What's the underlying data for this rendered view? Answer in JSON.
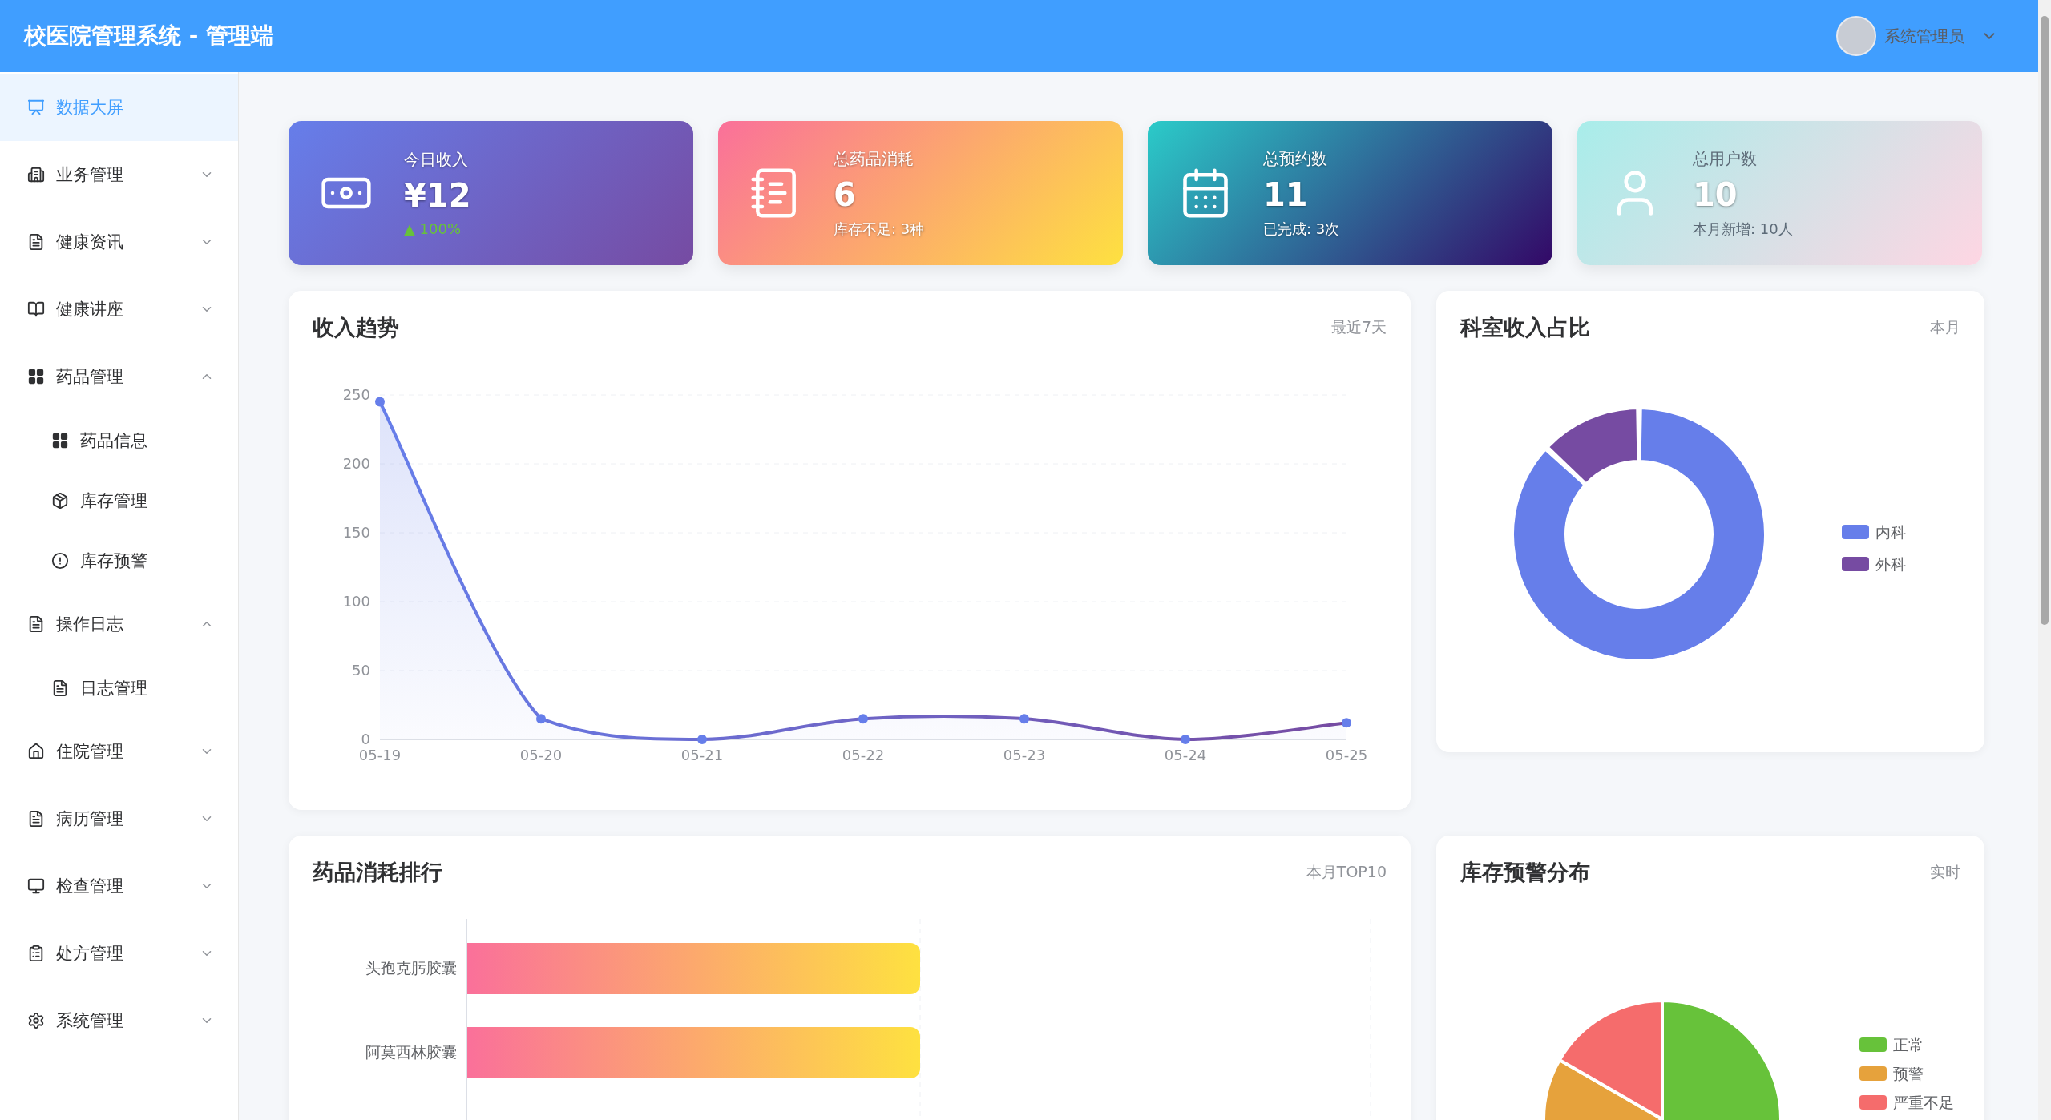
{
  "header": {
    "title": "校医院管理系统 - 管理端",
    "user": "系统管理员"
  },
  "sidebar": {
    "items": [
      {
        "kind": "link",
        "label": "数据大屏",
        "selected": true
      },
      {
        "kind": "group",
        "label": "业务管理",
        "expanded": false
      },
      {
        "kind": "group",
        "label": "健康资讯",
        "expanded": false
      },
      {
        "kind": "group",
        "label": "健康讲座",
        "expanded": false
      },
      {
        "kind": "group",
        "label": "药品管理",
        "expanded": true,
        "children": [
          {
            "label": "药品信息",
            "selected": false
          },
          {
            "label": "库存管理",
            "selected": false
          },
          {
            "label": "库存预警",
            "selected": false
          }
        ]
      },
      {
        "kind": "group",
        "label": "操作日志",
        "expanded": true,
        "children": [
          {
            "label": "日志管理",
            "selected": false
          }
        ]
      },
      {
        "kind": "group",
        "label": "住院管理",
        "expanded": false
      },
      {
        "kind": "group",
        "label": "病历管理",
        "expanded": false
      },
      {
        "kind": "group",
        "label": "检查管理",
        "expanded": false
      },
      {
        "kind": "group",
        "label": "处方管理",
        "expanded": false
      },
      {
        "kind": "group",
        "label": "系统管理",
        "expanded": false
      }
    ]
  },
  "stats": [
    {
      "label": "今日收入",
      "value": "¥12",
      "trend": {
        "arrow": "▲",
        "text": "100%"
      }
    },
    {
      "label": "总药品消耗",
      "value": "6",
      "note": "库存不足: 3种"
    },
    {
      "label": "总预约数",
      "value": "11",
      "note": "已完成: 3次"
    },
    {
      "label": "总用户数",
      "value": "10",
      "note": "本月新增: 10人"
    }
  ],
  "income_trend": {
    "title": "收入趋势",
    "period": "最近7天",
    "chart_data": {
      "type": "area",
      "categories": [
        "05-19",
        "05-20",
        "05-21",
        "05-22",
        "05-23",
        "05-24",
        "05-25"
      ],
      "values": [
        245,
        15,
        0,
        15,
        15,
        0,
        12
      ],
      "grid": true,
      "ylim": [
        0,
        250
      ],
      "yticks": [
        0,
        50,
        100,
        150,
        200,
        250
      ]
    }
  },
  "department_share": {
    "title": "科室收入占比",
    "period": "本月",
    "legend": [
      {
        "label": "内科",
        "color": "#667eea"
      },
      {
        "label": "外科",
        "color": "#764ba2"
      }
    ]
  },
  "drug_ranking": {
    "title": "药品消耗排行",
    "period": "本月TOP10",
    "labels": [
      "头孢克肟胶囊",
      "阿莫西林胶囊"
    ]
  },
  "stock_alert": {
    "title": "库存预警分布",
    "period": "实时",
    "legend": [
      {
        "label": "正常",
        "color": "#67c23a"
      },
      {
        "label": "预警",
        "color": "#e6a23c"
      },
      {
        "label": "严重不足",
        "color": "#f56c6c"
      }
    ]
  }
}
